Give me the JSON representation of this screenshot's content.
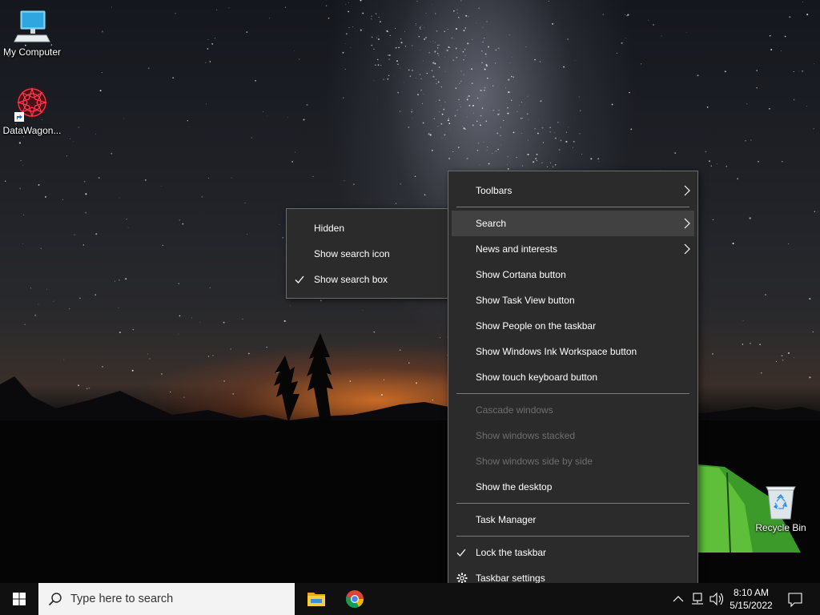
{
  "desktop": {
    "icons": [
      {
        "label": "My Computer",
        "icon": "computer-icon"
      },
      {
        "label": "DataWagon...",
        "icon": "datawagon-shortcut-icon"
      },
      {
        "label": "Recycle Bin",
        "icon": "recycle-bin-icon"
      }
    ]
  },
  "context_menu": {
    "items": {
      "toolbars": "Toolbars",
      "search": "Search",
      "news": "News and interests",
      "cortana": "Show Cortana button",
      "taskview": "Show Task View button",
      "people": "Show People on the taskbar",
      "ink": "Show Windows Ink Workspace button",
      "keyboard": "Show touch keyboard button",
      "cascade": "Cascade windows",
      "stacked": "Show windows stacked",
      "side": "Show windows side by side",
      "desktop": "Show the desktop",
      "taskmgr": "Task Manager",
      "lock": "Lock the taskbar",
      "settings": "Taskbar settings"
    }
  },
  "search_submenu": {
    "items": {
      "hidden": "Hidden",
      "icon": "Show search icon",
      "box": "Show search box"
    }
  },
  "taskbar": {
    "search_placeholder": "Type here to search",
    "time": "8:10 AM",
    "date": "5/15/2022"
  },
  "colors": {
    "menu_bg": "#2b2b2b",
    "menu_hover": "#414141",
    "menu_disabled_text": "#6e6e6e",
    "taskbar_bg": "#101010",
    "windows_blue": "#0078d7"
  }
}
